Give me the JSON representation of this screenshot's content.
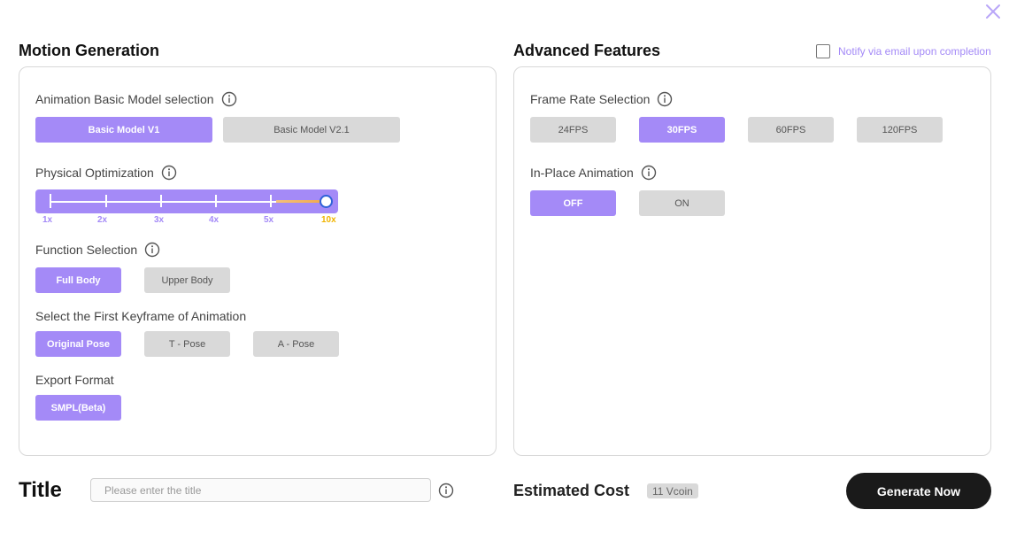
{
  "motion": {
    "title": "Motion Generation",
    "model_label": "Animation Basic Model selection",
    "models": [
      "Basic Model V1",
      "Basic Model V2.1"
    ],
    "selected_model": "Basic Model V1",
    "physical_label": "Physical Optimization",
    "slider_ticks": [
      "1x",
      "2x",
      "3x",
      "4x",
      "5x",
      "10x"
    ],
    "slider_value": "10x",
    "function_label": "Function Selection",
    "functions": [
      "Full Body",
      "Upper Body"
    ],
    "selected_function": "Full Body",
    "keyframe_label": "Select the First Keyframe of Animation",
    "keyframes": [
      "Original Pose",
      "T - Pose",
      "A - Pose"
    ],
    "selected_keyframe": "Original Pose",
    "export_label": "Export Format",
    "export_formats": [
      "SMPL(Beta)"
    ],
    "selected_export": "SMPL(Beta)"
  },
  "advanced": {
    "title": "Advanced Features",
    "notify_label": "Notify via email upon completion",
    "notify_checked": false,
    "frame_rate_label": "Frame Rate Selection",
    "frame_rates": [
      "24FPS",
      "30FPS",
      "60FPS",
      "120FPS"
    ],
    "selected_frame_rate": "30FPS",
    "inplace_label": "In-Place Animation",
    "inplace_options": [
      "OFF",
      "ON"
    ],
    "selected_inplace": "OFF"
  },
  "footer": {
    "title_label": "Title",
    "title_placeholder": "Please enter the title",
    "title_value": "",
    "cost_label": "Estimated Cost",
    "cost_value": "11 Vcoin",
    "generate_label": "Generate Now"
  },
  "colors": {
    "accent": "#a48af7",
    "inactive": "#d9d9d9",
    "slider_max_label": "#f0b400",
    "generate_bg": "#1a1a1a"
  },
  "icons": {
    "close": "close-icon",
    "info": "info-icon"
  }
}
